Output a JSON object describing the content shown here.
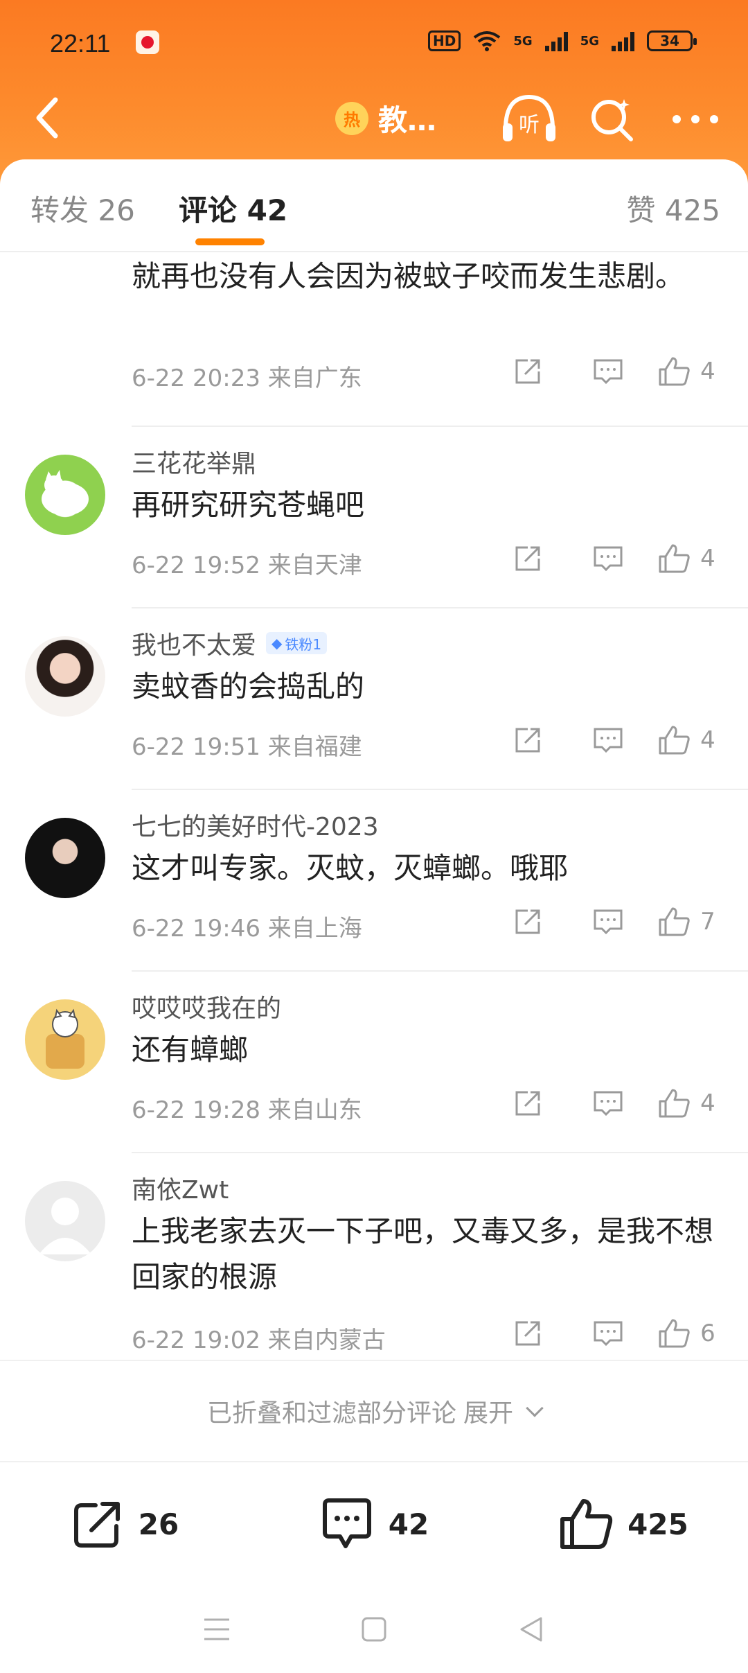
{
  "status_bar": {
    "time": "22:11",
    "hd_label": "HD",
    "network_1": "5G",
    "network_2": "5G",
    "battery": "34"
  },
  "nav": {
    "hot_badge": "热",
    "title": "教…",
    "listen_icon_text": "听"
  },
  "tabs": {
    "repost": "转发 26",
    "comment": "评论 42",
    "likes": "赞 425"
  },
  "comments": [
    {
      "text": "就再也没有人会因为被蚊子咬而发生悲剧。",
      "meta": "6-22 20:23 来自广东",
      "likes": "4"
    },
    {
      "name": "三花花举鼎",
      "text": "再研究研究苍蝇吧",
      "meta": "6-22 19:52 来自天津",
      "likes": "4"
    },
    {
      "name": "我也不太爱",
      "badge": "铁粉1",
      "text": "卖蚊香的会捣乱的",
      "meta": "6-22 19:51 来自福建",
      "likes": "4"
    },
    {
      "name": "七七的美好时代-2023",
      "text": "这才叫专家。灭蚊，灭蟑螂。哦耶",
      "meta": "6-22 19:46 来自上海",
      "likes": "7"
    },
    {
      "name": "哎哎哎我在的",
      "text": "还有蟑螂",
      "meta": "6-22 19:28 来自山东",
      "likes": "4"
    },
    {
      "name": "南依Zwt",
      "text": "上我老家去灭一下子吧，又毒又多，是我不想回家的根源",
      "meta": "6-22 19:02 来自内蒙古",
      "likes": "6"
    }
  ],
  "fold": {
    "text": "已折叠和过滤部分评论",
    "expand": "展开"
  },
  "bottom_bar": {
    "repost_count": "26",
    "comment_count": "42",
    "like_count": "425"
  },
  "colors": {
    "accent": "#ff8200",
    "header_top": "#fb7a22",
    "header_bottom": "#fe9a3a"
  }
}
